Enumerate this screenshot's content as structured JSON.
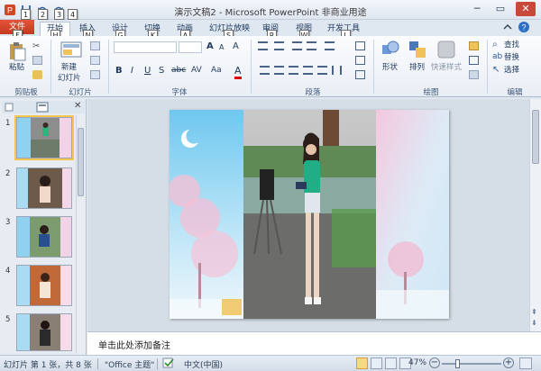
{
  "window": {
    "title": "演示文稿2 - Microsoft PowerPoint 非商业用途"
  },
  "keytips": {
    "quick_access": [
      "1",
      "2",
      "3",
      "4"
    ],
    "tabs": [
      "F",
      "H",
      "N",
      "G",
      "K",
      "A",
      "S",
      "R",
      "W",
      "L"
    ]
  },
  "tabs": [
    {
      "label": "文件"
    },
    {
      "label": "开始"
    },
    {
      "label": "插入"
    },
    {
      "label": "设计"
    },
    {
      "label": "切换"
    },
    {
      "label": "动画"
    },
    {
      "label": "幻灯片放映"
    },
    {
      "label": "审阅"
    },
    {
      "label": "视图"
    },
    {
      "label": "开发工具"
    }
  ],
  "ribbon": {
    "groups": {
      "clipboard": "剪贴板",
      "slides": "幻灯片",
      "font": "字体",
      "paragraph": "段落",
      "drawing": "绘图",
      "editing": "编辑"
    },
    "buttons": {
      "paste": "粘贴",
      "new_slide": "新建",
      "new_slide_2": "幻灯片",
      "shape": "形状",
      "arrange": "排列",
      "quick_styles": "快速样式",
      "find": "查找",
      "replace": "替换",
      "select": "选择"
    },
    "font_glyphs": {
      "grow": "A",
      "shrink": "A",
      "clear": "A",
      "bold": "B",
      "italic": "I",
      "underline": "U",
      "strike": "S",
      "shadow": "abc",
      "spacing": "AV",
      "case": "Aa",
      "color": "A"
    }
  },
  "thumbnails": [
    {
      "num": "1",
      "selected": true
    },
    {
      "num": "2",
      "selected": false
    },
    {
      "num": "3",
      "selected": false
    },
    {
      "num": "4",
      "selected": false
    },
    {
      "num": "5",
      "selected": false
    }
  ],
  "notes": {
    "placeholder": "单击此处添加备注"
  },
  "status": {
    "slide_info": "幻灯片 第 1 张，共 8 张",
    "theme": "\"Office 主题\"",
    "language": "中文(中国)",
    "zoom": "47%"
  },
  "colors": {
    "file_tab": "#d24726",
    "accent": "#1e395b",
    "selection": "#f3c64f"
  }
}
